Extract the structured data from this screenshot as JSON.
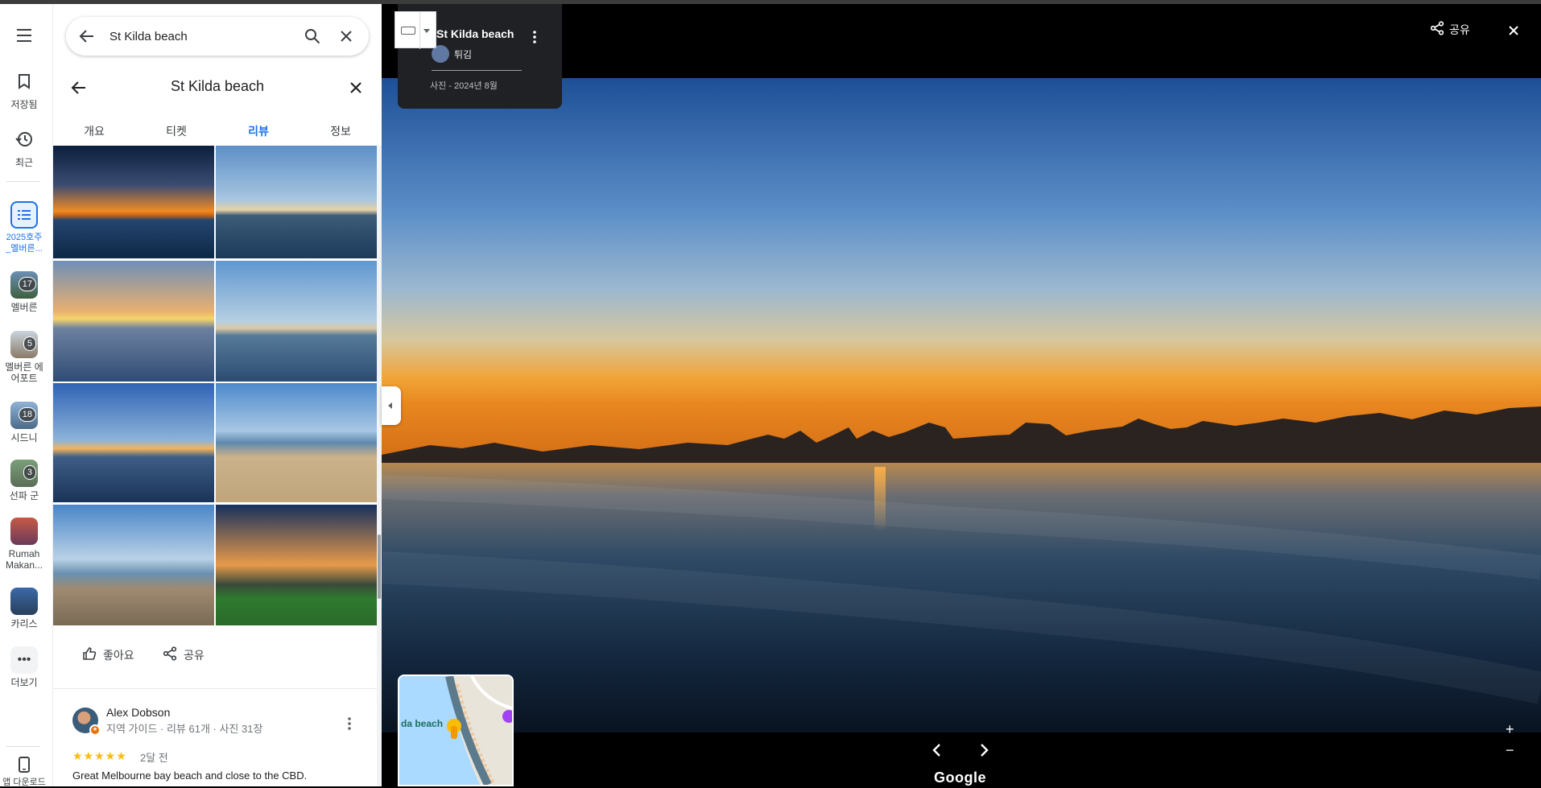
{
  "rail": {
    "saved": "저장됨",
    "recent": "최근",
    "lists": [
      {
        "label": "2025호주\n_멜버른...",
        "active": true
      },
      {
        "label": "멜버른",
        "badge": "17"
      },
      {
        "label": "멜버른 에\n어포트",
        "badge": "5"
      },
      {
        "label": "시드니",
        "badge": "18"
      },
      {
        "label": "선파 군",
        "badge": "3"
      },
      {
        "label": "Rumah\nMakan..."
      },
      {
        "label": "카리스"
      }
    ],
    "more": "더보기",
    "download": "앱 다운로드"
  },
  "search": {
    "value": "St Kilda beach"
  },
  "panel": {
    "title": "St Kilda beach",
    "tabs": [
      "개요",
      "티켓",
      "리뷰",
      "정보"
    ],
    "active_tab": 2,
    "like": "좋아요",
    "share": "공유"
  },
  "review": {
    "name": "Alex Dobson",
    "meta": "지역 가이드 · 리뷰 61개 · 사진 31장",
    "stars": "★★★★★",
    "date": "2달 전",
    "text": "Great Melbourne bay beach and close to the CBD."
  },
  "viewer": {
    "title": "St Kilda beach",
    "user": "튀김",
    "date": "사진 - 2024년 8월",
    "share": "공유",
    "logo": "Google",
    "map_label": "da beach"
  },
  "colors": {
    "accent": "#1a73e8",
    "star": "#fbbc04"
  }
}
